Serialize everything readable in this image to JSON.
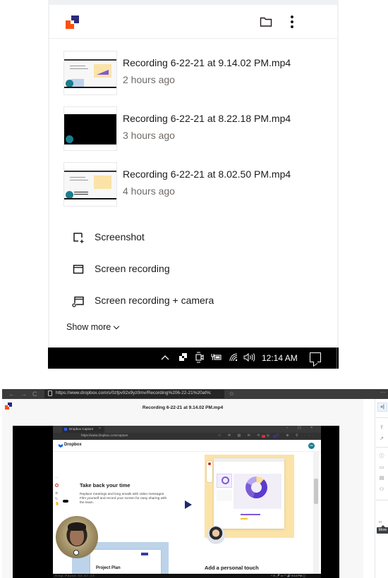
{
  "capture_popup": {
    "header": {
      "logo": "dropbox-capture-logo",
      "folder_icon": "folder-icon",
      "menu_icon": "more-vertical-icon"
    },
    "recordings": [
      {
        "title": "Recording 6-22-21 at 9.14.02 PM.mp4",
        "time": "2 hours ago",
        "thumbnail": "light"
      },
      {
        "title": "Recording 6-22-21 at 8.22.18 PM.mp4",
        "time": "3 hours ago",
        "thumbnail": "dark"
      },
      {
        "title": "Recording 6-22-21 at 8.02.50 PM.mp4",
        "time": "4 hours ago",
        "thumbnail": "light"
      }
    ],
    "actions": [
      {
        "label": "Screenshot",
        "icon": "screenshot-icon"
      },
      {
        "label": "Screen recording",
        "icon": "screen-recording-icon"
      },
      {
        "label": "Screen recording + camera",
        "icon": "screen-camera-icon"
      }
    ],
    "show_more": "Show more"
  },
  "taskbar_top": {
    "icons": [
      "^",
      "▣",
      "⎚",
      "🔋",
      "wifi",
      "🔊"
    ],
    "clock": "12:14 AM"
  },
  "browser": {
    "url": "https://www.dropbox.com/s/0zfpv92x9yz0mv/Recording%206-22-21%20at%209.14.02%20P...",
    "nav": {
      "back": "←",
      "forward": "→",
      "reload": "C"
    },
    "more": "···"
  },
  "viewer": {
    "title": "Recording 6-22-21 at 9.14.02 PM.mp4",
    "side_panel": {
      "collapse": "«|",
      "more_label": "···",
      "more_tooltip": "More"
    }
  },
  "captured_screen": {
    "tab_label": "Dropbox Capture",
    "tab_close": "×",
    "window_controls": "– ▢ ×",
    "url": "https://www.dropbox.com/capture",
    "extensions": "☆ ✲ ▤ ✉ ⟲ ◎ ♡ ⊕ ⚲ ···",
    "brand": "Dropbox",
    "avatar_initials": "MD",
    "heading": "Take back your time",
    "paragraph": "Replace meetings and long emails with video messages. Film yourself and record your screen for easy sharing with the team.",
    "project_title": "Project Plan",
    "personal_touch": "Add a personal touch",
    "taskbar_left": "Stop   Pause   02:47:13",
    "taskbar_right": "^ ⊙ 🎤 ▭ ◠ 🔊 9:14 PM  ▢"
  }
}
